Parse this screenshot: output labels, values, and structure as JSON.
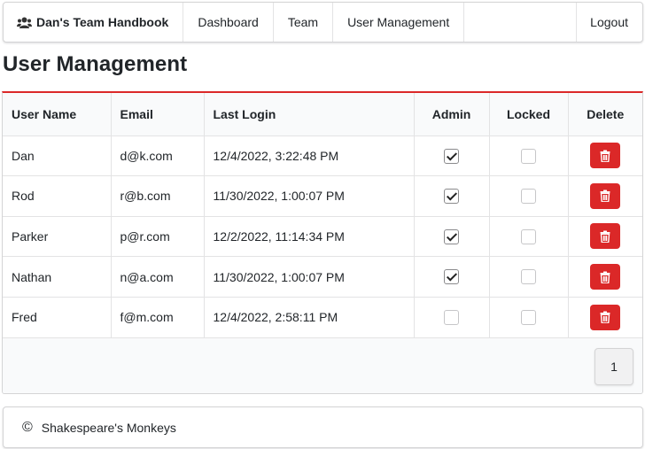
{
  "nav": {
    "brand": "Dan's Team Handbook",
    "brand_icon": "users-icon",
    "items": [
      {
        "label": "Dashboard"
      },
      {
        "label": "Team"
      },
      {
        "label": "User Management"
      }
    ],
    "logout": "Logout"
  },
  "page": {
    "title": "User Management"
  },
  "table": {
    "headers": {
      "username": "User Name",
      "email": "Email",
      "last_login": "Last Login",
      "admin": "Admin",
      "locked": "Locked",
      "delete": "Delete"
    },
    "rows": [
      {
        "username": "Dan",
        "email": "d@k.com",
        "last_login": "12/4/2022, 3:22:48 PM",
        "admin": true,
        "locked": false
      },
      {
        "username": "Rod",
        "email": "r@b.com",
        "last_login": "11/30/2022, 1:00:07 PM",
        "admin": true,
        "locked": false
      },
      {
        "username": "Parker",
        "email": "p@r.com",
        "last_login": "12/2/2022, 11:14:34 PM",
        "admin": true,
        "locked": false
      },
      {
        "username": "Nathan",
        "email": "n@a.com",
        "last_login": "11/30/2022, 1:00:07 PM",
        "admin": true,
        "locked": false
      },
      {
        "username": "Fred",
        "email": "f@m.com",
        "last_login": "12/4/2022, 2:58:11 PM",
        "admin": false,
        "locked": false
      }
    ],
    "pagination": {
      "current_page": "1"
    }
  },
  "footer": {
    "copyright_symbol": "©",
    "text": "Shakespeare's Monkeys"
  },
  "colors": {
    "accent": "#db2828",
    "header_bg": "#f9fafb",
    "border": "#e3e3e4"
  }
}
